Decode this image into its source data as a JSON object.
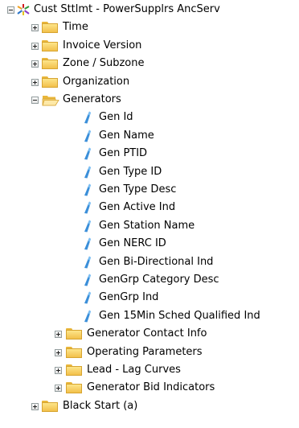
{
  "root": {
    "label": "Cust Sttlmt - PowerSupplrs AncServ",
    "icon": "cube-icon",
    "expanded": true
  },
  "level1_before": [
    {
      "label": "Time",
      "icon": "folder-icon",
      "expanded": false
    },
    {
      "label": "Invoice Version",
      "icon": "folder-icon",
      "expanded": false
    },
    {
      "label": "Zone / Subzone",
      "icon": "folder-icon",
      "expanded": false
    },
    {
      "label": "Organization",
      "icon": "folder-icon",
      "expanded": false
    }
  ],
  "generators": {
    "label": "Generators",
    "icon": "folder-open-icon",
    "expanded": true,
    "attributes": [
      "Gen Id",
      "Gen Name",
      "Gen PTID",
      "Gen Type ID",
      "Gen Type Desc",
      "Gen Active Ind",
      "Gen Station Name",
      "Gen NERC ID",
      "Gen Bi-Directional Ind",
      "GenGrp Category Desc",
      "GenGrp Ind",
      "Gen 15Min Sched Qualified Ind"
    ],
    "subfolders": [
      {
        "label": "Generator Contact Info",
        "icon": "folder-icon",
        "expanded": false
      },
      {
        "label": "Operating Parameters",
        "icon": "folder-icon",
        "expanded": false
      },
      {
        "label": "Lead - Lag Curves",
        "icon": "folder-icon",
        "expanded": false
      },
      {
        "label": "Generator Bid Indicators",
        "icon": "folder-icon",
        "expanded": false
      }
    ]
  },
  "level1_after": [
    {
      "label": "Black Start (a)",
      "icon": "folder-icon",
      "expanded": false
    }
  ],
  "colors": {
    "folder": "#f5c54e",
    "attribute": "#3b8fd9",
    "toggle_border": "#919b9c"
  }
}
